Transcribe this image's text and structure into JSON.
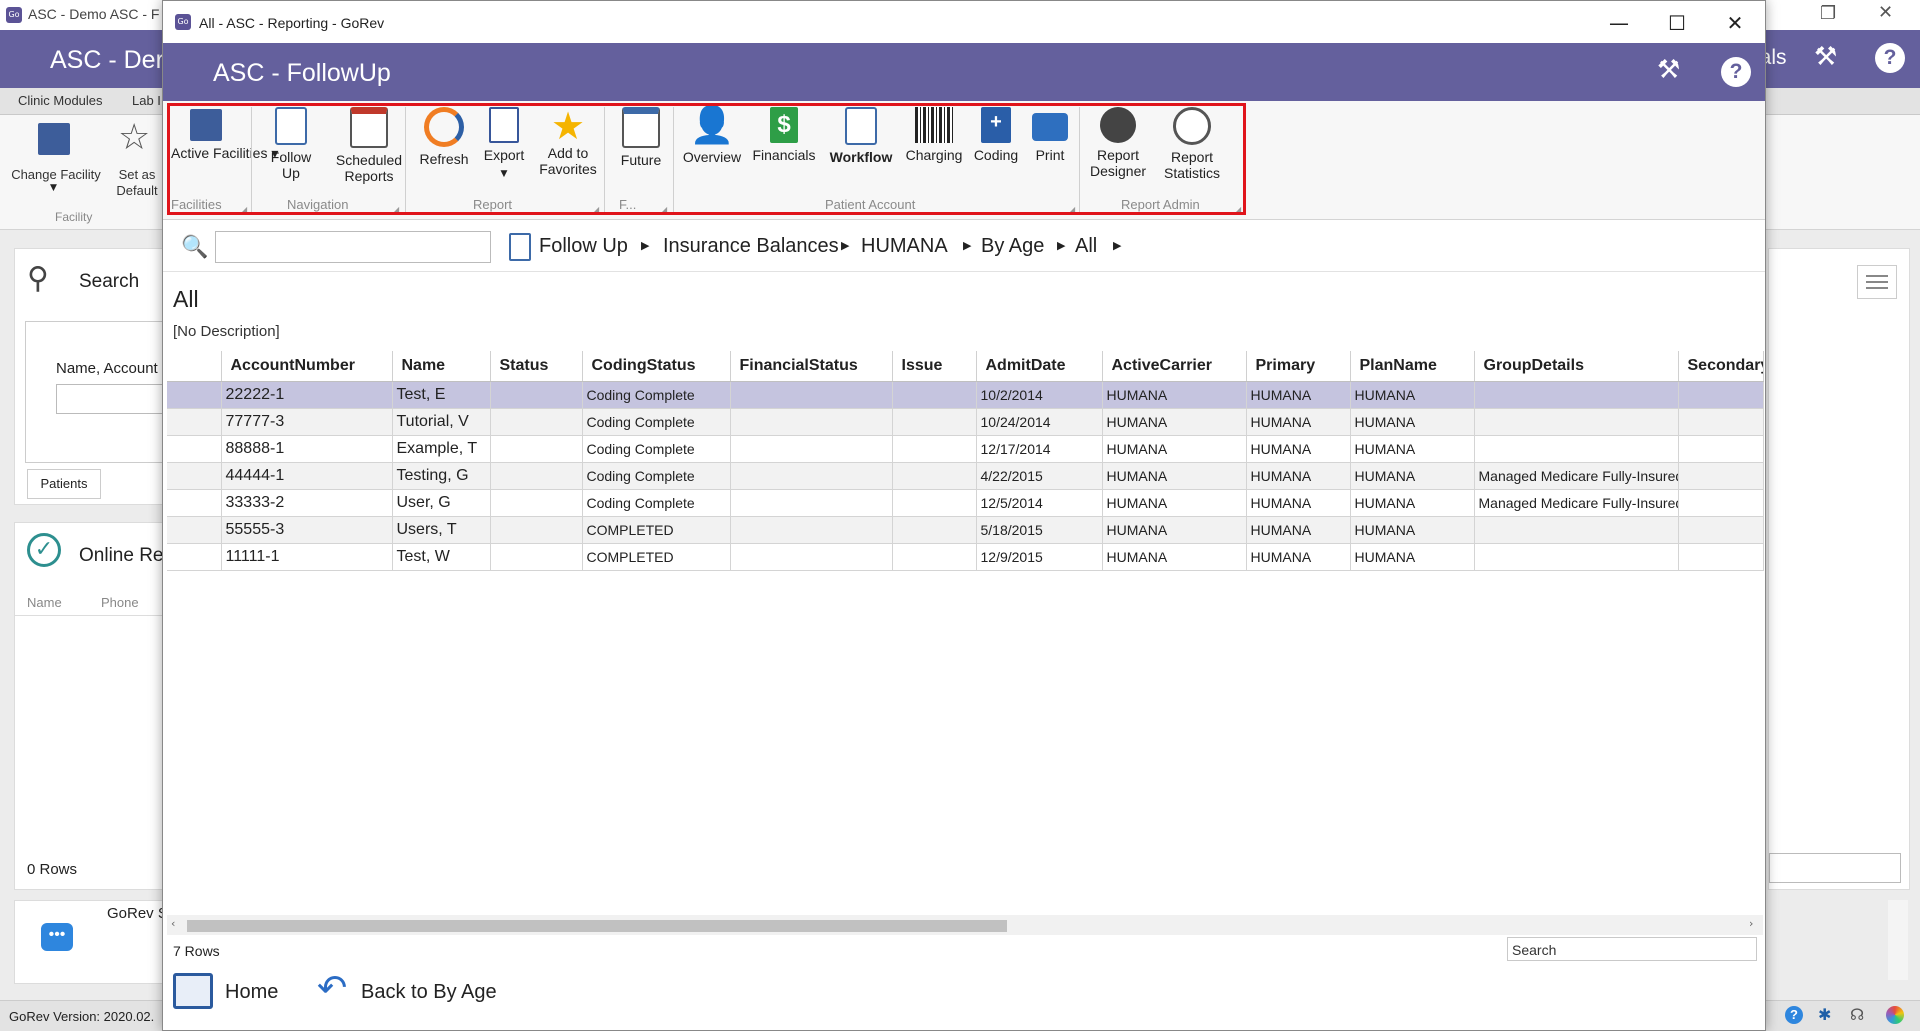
{
  "background_app": {
    "window_title": "ASC - Demo ASC - F",
    "header_title": "ASC - Der",
    "header_right_text": "ials",
    "tabs": [
      "Clinic Modules",
      "Lab I"
    ],
    "ribbon": {
      "change_facility": "Change Facility",
      "set_as_default": "Set as Default",
      "group_label": "Facility"
    },
    "search_panel": {
      "title": "Search",
      "field_label": "Name, Account",
      "tab": "Patients"
    },
    "online_panel": {
      "title": "Online Re",
      "columns": [
        "Name",
        "Phone"
      ],
      "rows_label": "0 Rows"
    },
    "chat_label": "GoRev S",
    "status_version": "GoRev Version: 2020.02."
  },
  "dialog": {
    "title": "All - ASC - Reporting - GoRev",
    "header_title": "ASC - FollowUp",
    "ribbon_groups": [
      {
        "label": "Facilities",
        "buttons": [
          {
            "label": "Active Facilities ▾"
          }
        ]
      },
      {
        "label": "Navigation",
        "buttons": [
          {
            "label": "Follow Up"
          },
          {
            "label": "Scheduled Reports"
          }
        ]
      },
      {
        "label": "Report",
        "buttons": [
          {
            "label": "Refresh"
          },
          {
            "label": "Export"
          },
          {
            "label": "Add to Favorites"
          }
        ]
      },
      {
        "label": "F...",
        "buttons": [
          {
            "label": "Future"
          }
        ]
      },
      {
        "label": "Patient Account",
        "buttons": [
          {
            "label": "Overview"
          },
          {
            "label": "Financials"
          },
          {
            "label": "Workflow"
          },
          {
            "label": "Charging"
          },
          {
            "label": "Coding"
          },
          {
            "label": "Print"
          }
        ]
      },
      {
        "label": "Report Admin",
        "buttons": [
          {
            "label": "Report Designer"
          },
          {
            "label": "Report Statistics"
          }
        ]
      }
    ],
    "search": {
      "value": "",
      "placeholder": ""
    },
    "breadcrumb": [
      "Follow Up",
      "Insurance Balances",
      "HUMANA",
      "By Age",
      "All"
    ],
    "report_title": "All",
    "report_description": "[No Description]",
    "grid": {
      "columns": [
        "",
        "AccountNumber",
        "Name",
        "Status",
        "CodingStatus",
        "FinancialStatus",
        "Issue",
        "AdmitDate",
        "ActiveCarrier",
        "Primary",
        "PlanName",
        "GroupDetails",
        "Secondary"
      ],
      "rows": [
        [
          "22222-1",
          "Test, E",
          "",
          "Coding Complete",
          "",
          "",
          "10/2/2014",
          "HUMANA",
          "HUMANA",
          "HUMANA",
          "",
          ""
        ],
        [
          "77777-3",
          "Tutorial, V",
          "",
          "Coding Complete",
          "",
          "",
          "10/24/2014",
          "HUMANA",
          "HUMANA",
          "HUMANA",
          "",
          ""
        ],
        [
          "88888-1",
          "Example, T",
          "",
          "Coding Complete",
          "",
          "",
          "12/17/2014",
          "HUMANA",
          "HUMANA",
          "HUMANA",
          "",
          ""
        ],
        [
          "44444-1",
          "Testing, G",
          "",
          "Coding Complete",
          "",
          "",
          "4/22/2015",
          "HUMANA",
          "HUMANA",
          "HUMANA",
          "Managed Medicare Fully-Insured",
          ""
        ],
        [
          "33333-2",
          "User, G",
          "",
          "Coding Complete",
          "",
          "",
          "12/5/2014",
          "HUMANA",
          "HUMANA",
          "HUMANA",
          "Managed Medicare Fully-Insured",
          ""
        ],
        [
          "55555-3",
          "Users, T",
          "",
          "COMPLETED",
          "",
          "",
          "5/18/2015",
          "HUMANA",
          "HUMANA",
          "HUMANA",
          "",
          ""
        ],
        [
          "11111-1",
          "Test, W",
          "",
          "COMPLETED",
          "",
          "",
          "12/9/2015",
          "HUMANA",
          "HUMANA",
          "HUMANA",
          "",
          ""
        ]
      ],
      "selected_row": 0
    },
    "rows_label": "7 Rows",
    "grid_search": "Search",
    "footer": {
      "home": "Home",
      "back": "Back to By Age"
    }
  },
  "colors": {
    "header": "#64609d",
    "selected_row": "#c5c4df",
    "highlight_outline": "#e0141b"
  }
}
